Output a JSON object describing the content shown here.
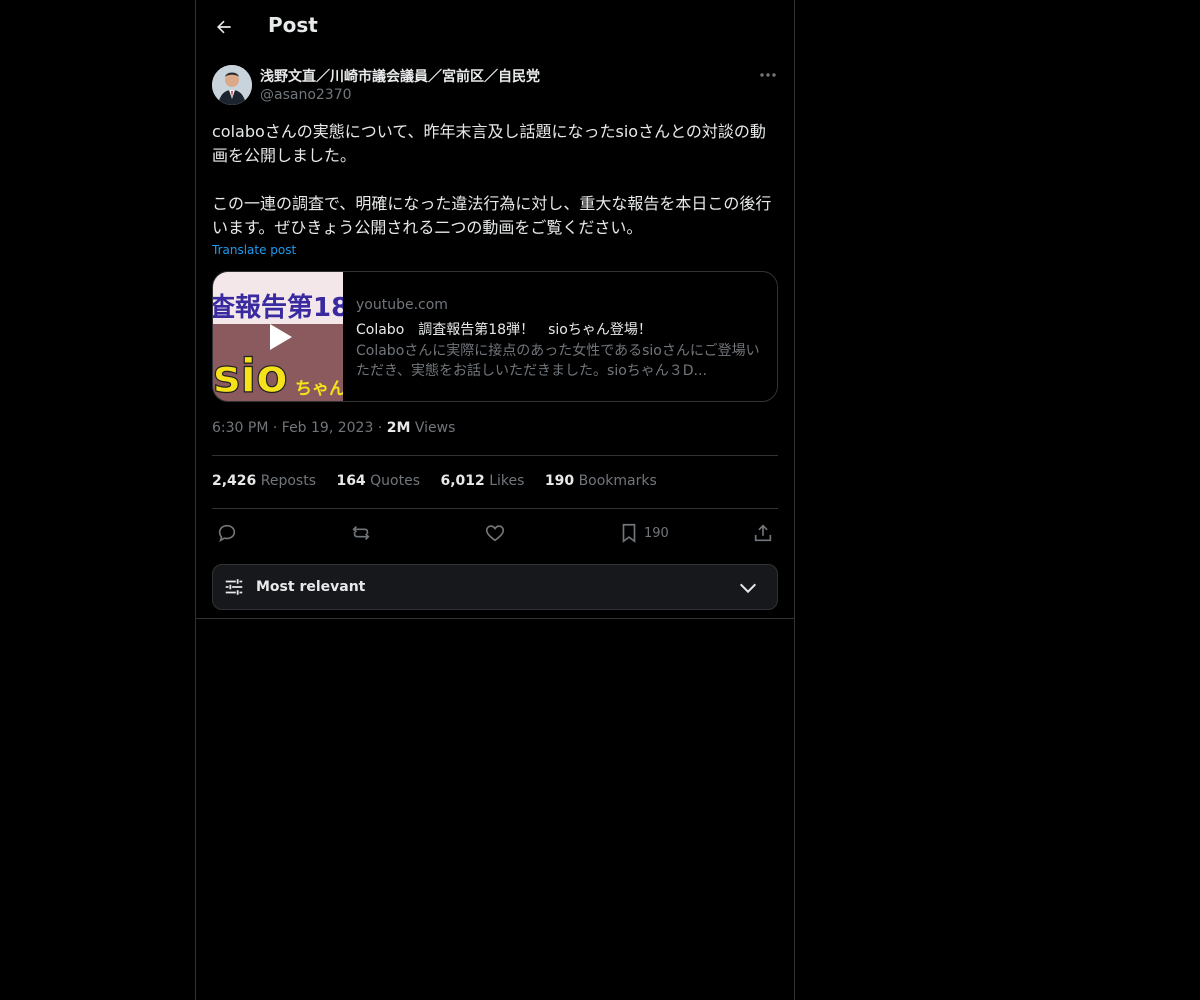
{
  "header": {
    "title": "Post"
  },
  "author": {
    "name": "浅野文直／川崎市議会議員／宮前区／自民党",
    "handle": "@asano2370"
  },
  "post": {
    "text": "colaboさんの実態について、昨年末言及し話題になったsioさんとの対談の動画を公開しました。\n\nこの一連の調査で、明確になった違法行為に対し、重大な報告を本日この後行います。ぜひきょう公開される二つの動画をご覧ください。",
    "translate_label": "Translate post"
  },
  "card": {
    "domain": "youtube.com",
    "title": "Colabo　調査報告第18弾！　sioちゃん登場！",
    "description": "Colaboさんに実際に接点のあった女性であるsioさんにご登場いただき、実態をお話しいただきました。sioちゃん３D...",
    "thumb_text_top": "査報告第18",
    "thumb_text_main": "sio",
    "thumb_text_side": "ちゃん"
  },
  "meta": {
    "time": "6:30 PM",
    "sep1": "·",
    "date": "Feb 19, 2023",
    "sep2": "·",
    "views_count": "2M",
    "views_label": "Views"
  },
  "stats": {
    "reposts_count": "2,426",
    "reposts_label": "Reposts",
    "quotes_count": "164",
    "quotes_label": "Quotes",
    "likes_count": "6,012",
    "likes_label": "Likes",
    "bookmarks_count": "190",
    "bookmarks_label": "Bookmarks"
  },
  "actions": {
    "bookmark_count": "190"
  },
  "sort": {
    "label": "Most relevant"
  },
  "colors": {
    "background": "#000000",
    "text": "#e7e9ea",
    "muted": "#71767b",
    "border": "#2f3336",
    "accent": "#1d9bf0"
  }
}
